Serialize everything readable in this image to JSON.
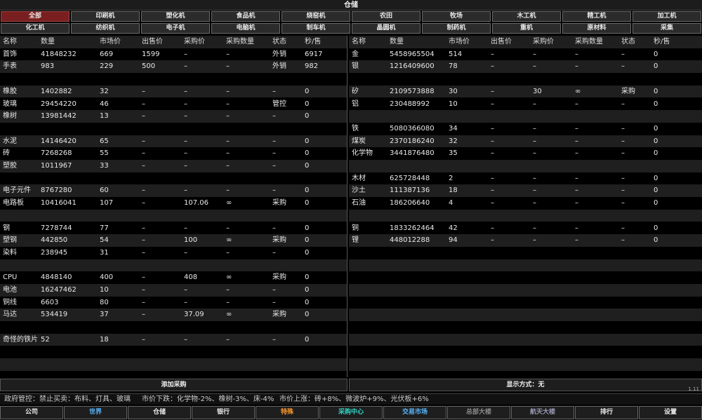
{
  "title": "仓储",
  "filters_row1": [
    "全部",
    "印刷机",
    "塑化机",
    "食品机",
    "烧窑机",
    "农田",
    "牧场",
    "木工机",
    "精工机",
    "加工机"
  ],
  "filters_row2": [
    "化工机",
    "纺织机",
    "电子机",
    "电脑机",
    "制车机",
    "晶圆机",
    "制药机",
    "重机",
    "原材料",
    "采集"
  ],
  "active_filter": "全部",
  "headers": [
    "名称",
    "数量",
    "市场价",
    "出售价",
    "采购价",
    "采购数量",
    "状态",
    "秒/售"
  ],
  "left_rows": [
    [
      "首饰",
      "41848232",
      "669",
      "1599",
      "–",
      "–",
      "外销",
      "6917"
    ],
    [
      "手表",
      "983",
      "229",
      "500",
      "–",
      "–",
      "外销",
      "982"
    ],
    null,
    [
      "橡胶",
      "1402882",
      "32",
      "–",
      "–",
      "–",
      "–",
      "0"
    ],
    [
      "玻璃",
      "29454220",
      "46",
      "–",
      "–",
      "–",
      "管控",
      "0"
    ],
    [
      "橡树",
      "13981442",
      "13",
      "–",
      "–",
      "–",
      "–",
      "0"
    ],
    null,
    [
      "水泥",
      "14146420",
      "65",
      "–",
      "–",
      "–",
      "–",
      "0"
    ],
    [
      "砖",
      "7268268",
      "55",
      "–",
      "–",
      "–",
      "–",
      "0"
    ],
    [
      "塑胶",
      "1011967",
      "33",
      "–",
      "–",
      "–",
      "–",
      "0"
    ],
    null,
    [
      "电子元件",
      "8767280",
      "60",
      "–",
      "–",
      "–",
      "–",
      "0"
    ],
    [
      "电路板",
      "10416041",
      "107",
      "–",
      "107.06",
      "∞",
      "采购",
      "0"
    ],
    null,
    [
      "钢",
      "7278744",
      "77",
      "–",
      "–",
      "–",
      "–",
      "0"
    ],
    [
      "塑钢",
      "442850",
      "54",
      "–",
      "100",
      "∞",
      "采购",
      "0"
    ],
    [
      "染料",
      "238945",
      "31",
      "–",
      "–",
      "–",
      "–",
      "0"
    ],
    null,
    [
      "CPU",
      "4848140",
      "400",
      "–",
      "408",
      "∞",
      "采购",
      "0"
    ],
    [
      "电池",
      "16247462",
      "10",
      "–",
      "–",
      "–",
      "–",
      "0"
    ],
    [
      "铜线",
      "6603",
      "80",
      "–",
      "–",
      "–",
      "–",
      "0"
    ],
    [
      "马达",
      "534419",
      "37",
      "–",
      "37.09",
      "∞",
      "采购",
      "0"
    ],
    null,
    [
      "奇怪的铁片",
      "52",
      "18",
      "–",
      "–",
      "–",
      "–",
      "0"
    ],
    null,
    null,
    null
  ],
  "right_rows": [
    [
      "金",
      "5458965504",
      "514",
      "–",
      "–",
      "–",
      "–",
      "0"
    ],
    [
      "银",
      "1216409600",
      "78",
      "–",
      "–",
      "–",
      "–",
      "0"
    ],
    null,
    [
      "矽",
      "2109573888",
      "30",
      "–",
      "30",
      "∞",
      "采购",
      "0"
    ],
    [
      "铝",
      "230488992",
      "10",
      "–",
      "–",
      "–",
      "–",
      "0"
    ],
    null,
    [
      "铁",
      "5080366080",
      "34",
      "–",
      "–",
      "–",
      "–",
      "0"
    ],
    [
      "煤炭",
      "2370186240",
      "32",
      "–",
      "–",
      "–",
      "–",
      "0"
    ],
    [
      "化学物",
      "3441876480",
      "35",
      "–",
      "–",
      "–",
      "–",
      "0"
    ],
    null,
    [
      "木材",
      "625728448",
      "2",
      "–",
      "–",
      "–",
      "–",
      "0"
    ],
    [
      "沙土",
      "111387136",
      "18",
      "–",
      "–",
      "–",
      "–",
      "0"
    ],
    [
      "石油",
      "186206640",
      "4",
      "–",
      "–",
      "–",
      "–",
      "0"
    ],
    null,
    [
      "铜",
      "1833262464",
      "42",
      "–",
      "–",
      "–",
      "–",
      "0"
    ],
    [
      "锂",
      "448012288",
      "94",
      "–",
      "–",
      "–",
      "–",
      "0"
    ]
  ],
  "add_purchase_label": "添加采购",
  "display_mode_label": "显示方式：无",
  "version": "1.11",
  "ticker": {
    "policy": "政府管控：禁止买卖：布料、灯具、玻璃",
    "down": "市价下跌：化学物-2%、橡树-3%、床-4%",
    "up": "市价上涨：砖+8%、微波炉+9%、光伏板+6%"
  },
  "nav": [
    {
      "label": "公司",
      "color": "#e8e8e8"
    },
    {
      "label": "世界",
      "color": "#5ab8ff"
    },
    {
      "label": "仓储",
      "color": "#e8e8e8"
    },
    {
      "label": "银行",
      "color": "#e8e8e8"
    },
    {
      "label": "特殊",
      "color": "#ff9a2e"
    },
    {
      "label": "采购中心",
      "color": "#32d0c0"
    },
    {
      "label": "交易市场",
      "color": "#5ab8ff"
    },
    {
      "label": "总部大楼",
      "color": "#8a8a8a"
    },
    {
      "label": "航天大楼",
      "color": "#9a9ab8"
    },
    {
      "label": "排行",
      "color": "#e8e8e8"
    },
    {
      "label": "设置",
      "color": "#e8e8e8"
    }
  ]
}
